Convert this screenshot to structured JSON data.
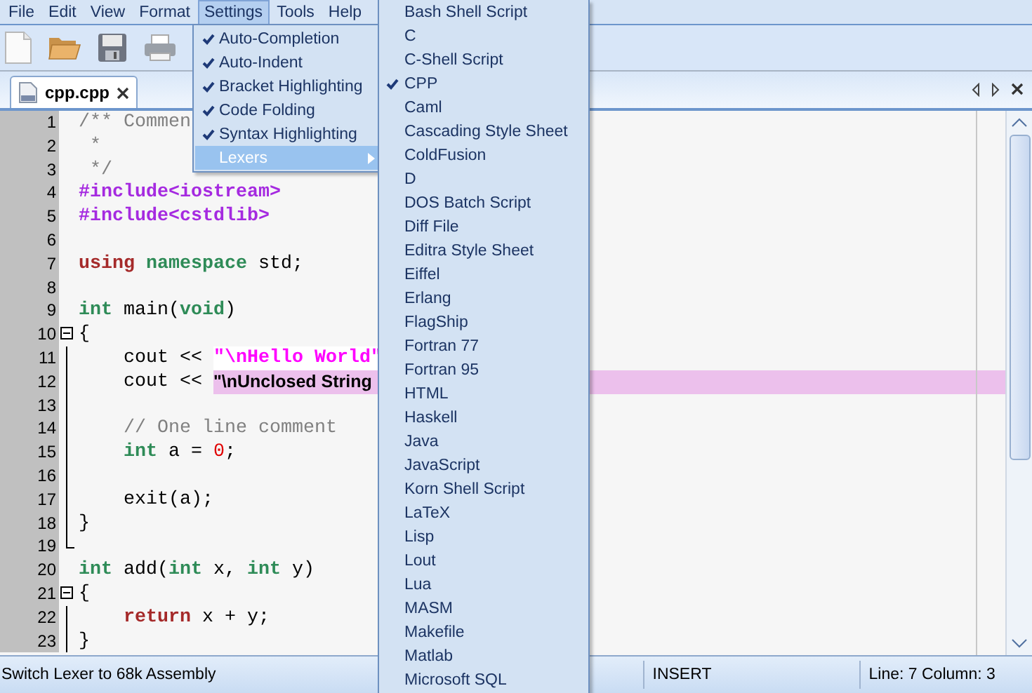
{
  "menu_bar": [
    {
      "label": "File",
      "selected": false
    },
    {
      "label": "Edit",
      "selected": false
    },
    {
      "label": "View",
      "selected": false
    },
    {
      "label": "Format",
      "selected": false
    },
    {
      "label": "Settings",
      "selected": true
    },
    {
      "label": "Tools",
      "selected": false
    },
    {
      "label": "Help",
      "selected": false
    }
  ],
  "tabs": [
    {
      "label": "cpp.cpp",
      "selected": true
    }
  ],
  "editor": {
    "lines": [
      {
        "number": "1",
        "kind": "plain",
        "tokens": [
          {
            "kind": "comment",
            "text": "/** Commen"
          }
        ]
      },
      {
        "number": "2",
        "kind": "plain",
        "tokens": [
          {
            "kind": "comment",
            "text": " *"
          }
        ]
      },
      {
        "number": "3",
        "kind": "plain",
        "tokens": [
          {
            "kind": "comment",
            "text": " */"
          }
        ]
      },
      {
        "number": "4",
        "kind": "plain",
        "tokens": [
          {
            "kind": "preprocessor",
            "text": "#include<iostream>"
          }
        ]
      },
      {
        "number": "5",
        "kind": "plain",
        "tokens": [
          {
            "kind": "preprocessor",
            "text": "#include<cstdlib>"
          }
        ]
      },
      {
        "number": "6",
        "kind": "plain"
      },
      {
        "number": "7",
        "kind": "plain",
        "tokens": [
          {
            "kind": "keyword",
            "text": "using"
          },
          {
            "kind": "type",
            "text": " namespace"
          },
          {
            "kind": "plain",
            "text": " std;"
          }
        ]
      },
      {
        "number": "8",
        "kind": "plain"
      },
      {
        "number": "9",
        "kind": "plain",
        "tokens": [
          {
            "kind": "type",
            "text": "int"
          },
          {
            "kind": "plain",
            "text": " main("
          },
          {
            "kind": "type",
            "text": "void"
          },
          {
            "kind": "plain",
            "text": ")"
          }
        ]
      },
      {
        "number": "10",
        "kind": "fold-start",
        "tokens": [
          {
            "kind": "plain",
            "text": "{"
          }
        ]
      },
      {
        "number": "11",
        "kind": "fold-body",
        "tokens": [
          {
            "kind": "plain",
            "text": "    cout << "
          },
          {
            "kind": "string",
            "text": "\"\\nHello World\""
          }
        ]
      },
      {
        "number": "12",
        "kind": "fold-body",
        "tokens": [
          {
            "kind": "plain",
            "text": "    cout << "
          },
          {
            "kind": "unclosed",
            "text": "\"\\nUnclosed String"
          }
        ]
      },
      {
        "number": "13",
        "kind": "fold-body"
      },
      {
        "number": "14",
        "kind": "fold-body",
        "tokens": [
          {
            "kind": "comment",
            "text": "    // One line comment"
          }
        ]
      },
      {
        "number": "15",
        "kind": "fold-body",
        "tokens": [
          {
            "kind": "type",
            "text": "    int"
          },
          {
            "kind": "plain",
            "text": " a = "
          },
          {
            "kind": "number",
            "text": "0"
          },
          {
            "kind": "plain",
            "text": ";"
          }
        ]
      },
      {
        "number": "16",
        "kind": "fold-body"
      },
      {
        "number": "17",
        "kind": "fold-body",
        "tokens": [
          {
            "kind": "plain",
            "text": "    exit(a);"
          }
        ]
      },
      {
        "number": "18",
        "kind": "fold-body",
        "tokens": [
          {
            "kind": "plain",
            "text": "}"
          }
        ]
      },
      {
        "number": "19",
        "kind": "fold-end"
      },
      {
        "number": "20",
        "kind": "plain",
        "tokens": [
          {
            "kind": "type",
            "text": "int"
          },
          {
            "kind": "plain",
            "text": " add("
          },
          {
            "kind": "type",
            "text": "int"
          },
          {
            "kind": "plain",
            "text": " x, "
          },
          {
            "kind": "type",
            "text": "int"
          },
          {
            "kind": "plain",
            "text": " y)"
          }
        ]
      },
      {
        "number": "21",
        "kind": "fold-start",
        "tokens": [
          {
            "kind": "plain",
            "text": "{"
          }
        ]
      },
      {
        "number": "22",
        "kind": "fold-body",
        "tokens": [
          {
            "kind": "keyword",
            "text": "    return"
          },
          {
            "kind": "plain",
            "text": " x + y;"
          }
        ]
      },
      {
        "number": "23",
        "kind": "fold-body",
        "tokens": [
          {
            "kind": "plain",
            "text": "}"
          }
        ]
      }
    ]
  },
  "settings_menu": {
    "items": [
      {
        "kind": "check",
        "label": "Auto-Completion",
        "checked": true
      },
      {
        "kind": "check",
        "label": "Auto-Indent",
        "checked": true
      },
      {
        "kind": "check",
        "label": "Bracket Highlighting",
        "checked": true
      },
      {
        "kind": "check",
        "label": "Code Folding",
        "checked": true
      },
      {
        "kind": "check",
        "label": "Syntax Highlighting",
        "checked": true
      },
      {
        "kind": "submenu",
        "label": "Lexers",
        "selected": true
      }
    ]
  },
  "lexers_menu": {
    "items": [
      {
        "label": "Bash Shell Script",
        "checked": false
      },
      {
        "label": "C",
        "checked": false
      },
      {
        "label": "C-Shell Script",
        "checked": false
      },
      {
        "label": "CPP",
        "checked": true
      },
      {
        "label": "Caml",
        "checked": false
      },
      {
        "label": "Cascading Style Sheet",
        "checked": false
      },
      {
        "label": "ColdFusion",
        "checked": false
      },
      {
        "label": "D",
        "checked": false
      },
      {
        "label": "DOS Batch Script",
        "checked": false
      },
      {
        "label": "Diff File",
        "checked": false
      },
      {
        "label": "Editra Style Sheet",
        "checked": false
      },
      {
        "label": "Eiffel",
        "checked": false
      },
      {
        "label": "Erlang",
        "checked": false
      },
      {
        "label": "FlagShip",
        "checked": false
      },
      {
        "label": "Fortran 77",
        "checked": false
      },
      {
        "label": "Fortran 95",
        "checked": false
      },
      {
        "label": "HTML",
        "checked": false
      },
      {
        "label": "Haskell",
        "checked": false
      },
      {
        "label": "Java",
        "checked": false
      },
      {
        "label": "JavaScript",
        "checked": false
      },
      {
        "label": "Korn Shell Script",
        "checked": false
      },
      {
        "label": "LaTeX",
        "checked": false
      },
      {
        "label": "Lisp",
        "checked": false
      },
      {
        "label": "Lout",
        "checked": false
      },
      {
        "label": "Lua",
        "checked": false
      },
      {
        "label": "MASM",
        "checked": false
      },
      {
        "label": "Makefile",
        "checked": false
      },
      {
        "label": "Matlab",
        "checked": false
      },
      {
        "label": "Microsoft SQL",
        "checked": false
      }
    ]
  },
  "status_bar": {
    "message": "Switch Lexer to 68k Assembly",
    "mode": "INSERT",
    "position": "Line: 7  Column: 3"
  }
}
